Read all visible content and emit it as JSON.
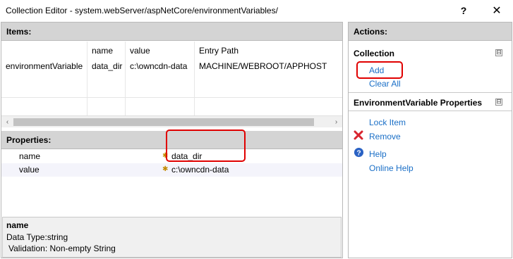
{
  "window": {
    "title": "Collection Editor - system.webServer/aspNetCore/environmentVariables/",
    "help_label": "?",
    "close_label": "✕"
  },
  "items_panel": {
    "header": "Items:",
    "columns": [
      "",
      "name",
      "value",
      "Entry Path"
    ],
    "rows": [
      {
        "type": "environmentVariable",
        "name": "data_dir",
        "value": "c:\\owncdn-data",
        "entry_path": "MACHINE/WEBROOT/APPHOST"
      }
    ],
    "scroll_left": "‹",
    "scroll_right": "›"
  },
  "properties_panel": {
    "header": "Properties:",
    "rows": [
      {
        "name": "name",
        "value": "data_dir",
        "marker": "✱"
      },
      {
        "name": "value",
        "value": "c:\\owncdn-data",
        "marker": "✱"
      }
    ]
  },
  "description": {
    "title": "name",
    "line1": "Data Type:string",
    "line2": "Validation: Non-empty String"
  },
  "actions": {
    "header": "Actions:",
    "collection": {
      "title": "Collection",
      "collapse": "⊟",
      "add": "Add",
      "clear_all": "Clear All"
    },
    "env_props": {
      "title": "EnvironmentVariable Properties",
      "collapse": "⊟",
      "lock_item": "Lock Item",
      "remove": "Remove",
      "help": "Help",
      "online_help": "Online Help"
    }
  },
  "colors": {
    "link": "#1a6fc7",
    "highlight": "#e00000",
    "header_bg": "#d4d4d4"
  }
}
